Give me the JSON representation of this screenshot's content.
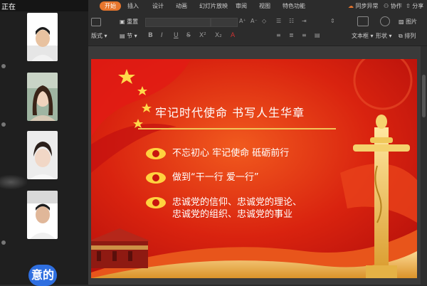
{
  "left_panel": {
    "status_text": "正在",
    "participant_labels": [
      "",
      "",
      "",
      ""
    ],
    "mic_text": "",
    "bubble_text": "意的"
  },
  "toolbar": {
    "tabs": [
      {
        "label": "开始",
        "active": true
      },
      {
        "label": "插入"
      },
      {
        "label": "设计"
      },
      {
        "label": "动画"
      },
      {
        "label": "幻灯片放映"
      },
      {
        "label": "审阅"
      },
      {
        "label": "视图"
      },
      {
        "label": "特色功能"
      }
    ],
    "right_items": [
      "同步异常",
      "协作",
      "分享"
    ],
    "ribbon": {
      "reset_label": "重置",
      "layout_label": "版式",
      "section_label": "节",
      "format_buttons": [
        "B",
        "I",
        "U",
        "S",
        "X²",
        "X₂",
        "A"
      ],
      "textbox_label": "文本框",
      "shape_label": "形状",
      "arrange_label": "排列",
      "picture_label": "图片"
    },
    "accent_color": "#e8762d"
  },
  "slide": {
    "title": "牢记时代使命 书写人生华章",
    "bullets": [
      "不忘初心 牢记使命 砥砺前行",
      "做到“干一行 爱一行”",
      "忠诚党的信仰、忠诚党的理论、\n忠诚党的组织、忠诚党的事业"
    ],
    "theme_colors": {
      "red": "#c8140f",
      "gold": "#f3c35a",
      "white": "#ffffff"
    }
  }
}
